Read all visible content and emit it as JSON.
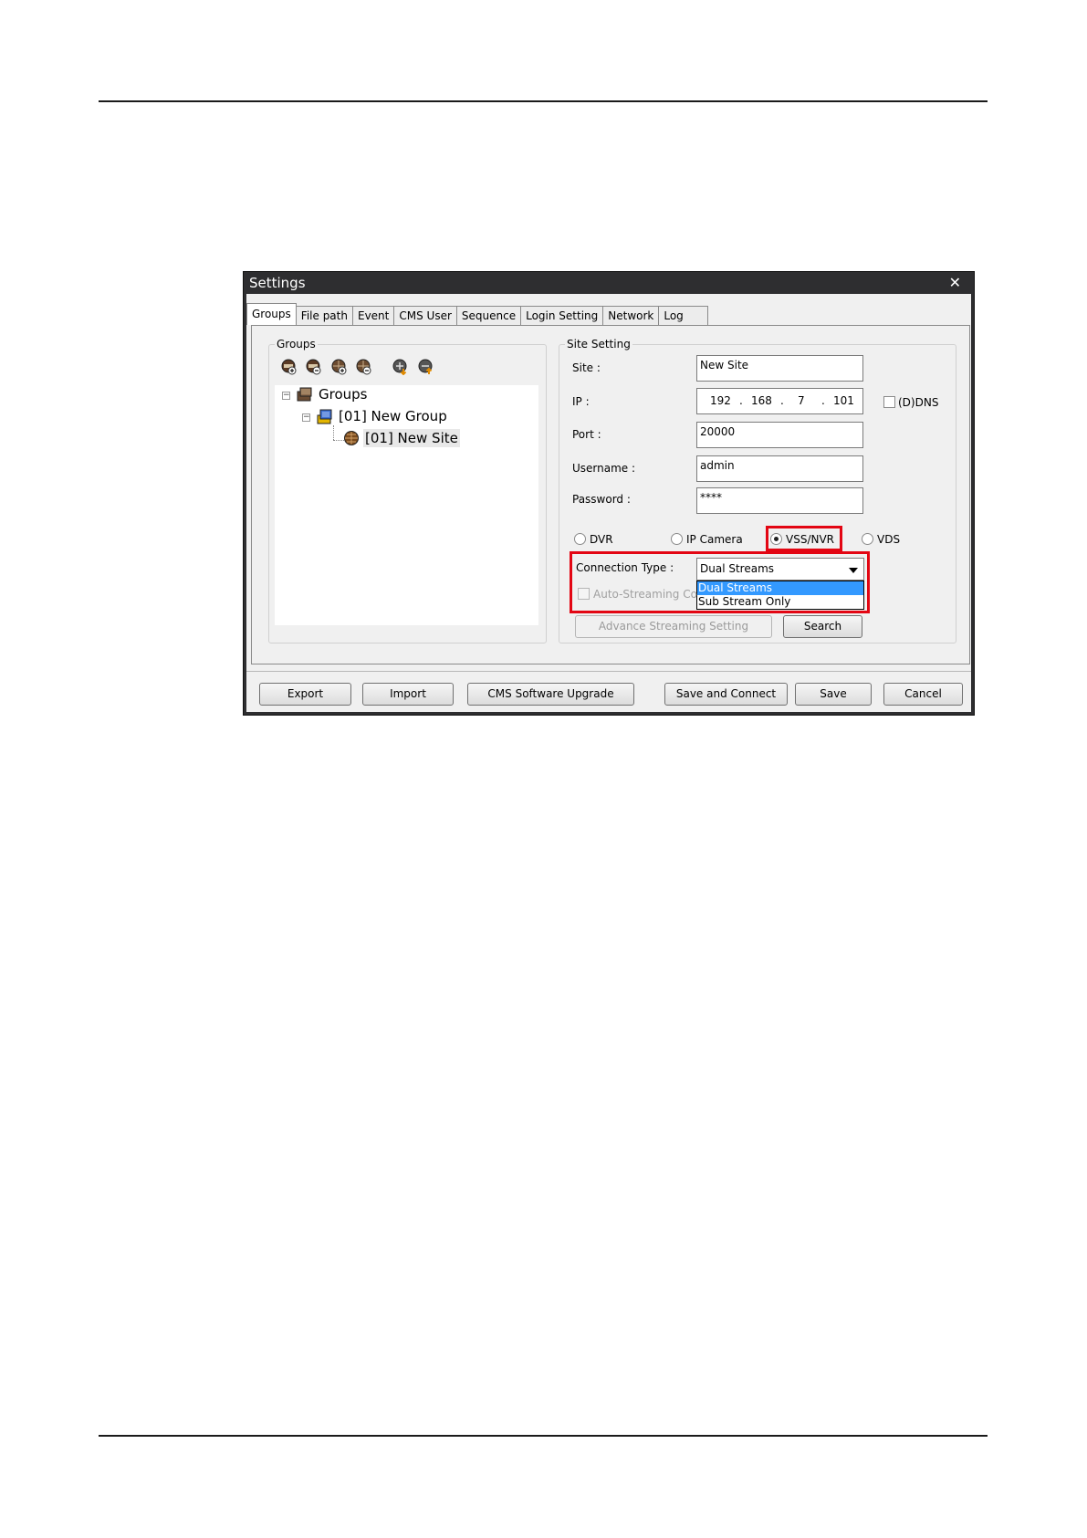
{
  "window": {
    "title": "Settings",
    "close_glyph": "✕"
  },
  "tabs": [
    {
      "label": "Groups",
      "active": true
    },
    {
      "label": "File path"
    },
    {
      "label": "Event"
    },
    {
      "label": "CMS User"
    },
    {
      "label": "Sequence"
    },
    {
      "label": "Login Setting"
    },
    {
      "label": "Network"
    },
    {
      "label": "Log"
    }
  ],
  "groups_panel": {
    "title": "Groups",
    "toolbar_icons": [
      "add-group-icon",
      "remove-group-icon",
      "add-site-icon",
      "remove-site-icon",
      "import-site-icon",
      "export-site-icon"
    ],
    "tree": {
      "root": {
        "label": "Groups",
        "expander": "−"
      },
      "group": {
        "label": "[01] New Group",
        "expander": "−"
      },
      "site": {
        "label": "[01] New Site"
      }
    }
  },
  "site_setting": {
    "title": "Site Setting",
    "site_label": "Site :",
    "site_value": "New Site",
    "ip_label": "IP :",
    "ip": {
      "o1": "192",
      "o2": "168",
      "o3": "7",
      "o4": "101",
      "dot": "."
    },
    "ddns_label": "(D)DNS",
    "ddns_checked": false,
    "port_label": "Port :",
    "port_value": "20000",
    "username_label": "Username :",
    "username_value": "admin",
    "password_label": "Password :",
    "password_value": "****",
    "device_types": [
      {
        "label": "DVR",
        "selected": false
      },
      {
        "label": "IP Camera",
        "selected": false
      },
      {
        "label": "VSS/NVR",
        "selected": true
      },
      {
        "label": "VDS",
        "selected": false
      }
    ],
    "connection_type_label": "Connection Type :",
    "connection_type_value": "Dual Streams",
    "connection_type_options": [
      "Dual Streams",
      "Sub Stream Only"
    ],
    "auto_streaming_label": "Auto-Streaming Co",
    "advance_button": "Advance Streaming Setting",
    "search_button": "Search",
    "highlight_color": "#e30613"
  },
  "footer_buttons": {
    "export": "Export",
    "import": "Import",
    "upgrade": "CMS Software Upgrade",
    "save_connect": "Save and Connect",
    "save": "Save",
    "cancel": "Cancel"
  }
}
